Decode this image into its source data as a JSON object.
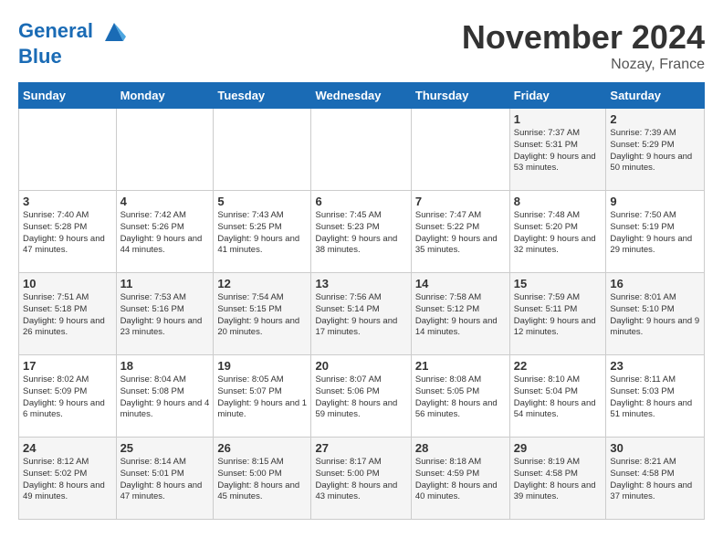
{
  "header": {
    "logo_line1": "General",
    "logo_line2": "Blue",
    "month": "November 2024",
    "location": "Nozay, France"
  },
  "weekdays": [
    "Sunday",
    "Monday",
    "Tuesday",
    "Wednesday",
    "Thursday",
    "Friday",
    "Saturday"
  ],
  "weeks": [
    [
      {
        "day": "",
        "info": ""
      },
      {
        "day": "",
        "info": ""
      },
      {
        "day": "",
        "info": ""
      },
      {
        "day": "",
        "info": ""
      },
      {
        "day": "",
        "info": ""
      },
      {
        "day": "1",
        "info": "Sunrise: 7:37 AM\nSunset: 5:31 PM\nDaylight: 9 hours\nand 53 minutes."
      },
      {
        "day": "2",
        "info": "Sunrise: 7:39 AM\nSunset: 5:29 PM\nDaylight: 9 hours\nand 50 minutes."
      }
    ],
    [
      {
        "day": "3",
        "info": "Sunrise: 7:40 AM\nSunset: 5:28 PM\nDaylight: 9 hours\nand 47 minutes."
      },
      {
        "day": "4",
        "info": "Sunrise: 7:42 AM\nSunset: 5:26 PM\nDaylight: 9 hours\nand 44 minutes."
      },
      {
        "day": "5",
        "info": "Sunrise: 7:43 AM\nSunset: 5:25 PM\nDaylight: 9 hours\nand 41 minutes."
      },
      {
        "day": "6",
        "info": "Sunrise: 7:45 AM\nSunset: 5:23 PM\nDaylight: 9 hours\nand 38 minutes."
      },
      {
        "day": "7",
        "info": "Sunrise: 7:47 AM\nSunset: 5:22 PM\nDaylight: 9 hours\nand 35 minutes."
      },
      {
        "day": "8",
        "info": "Sunrise: 7:48 AM\nSunset: 5:20 PM\nDaylight: 9 hours\nand 32 minutes."
      },
      {
        "day": "9",
        "info": "Sunrise: 7:50 AM\nSunset: 5:19 PM\nDaylight: 9 hours\nand 29 minutes."
      }
    ],
    [
      {
        "day": "10",
        "info": "Sunrise: 7:51 AM\nSunset: 5:18 PM\nDaylight: 9 hours\nand 26 minutes."
      },
      {
        "day": "11",
        "info": "Sunrise: 7:53 AM\nSunset: 5:16 PM\nDaylight: 9 hours\nand 23 minutes."
      },
      {
        "day": "12",
        "info": "Sunrise: 7:54 AM\nSunset: 5:15 PM\nDaylight: 9 hours\nand 20 minutes."
      },
      {
        "day": "13",
        "info": "Sunrise: 7:56 AM\nSunset: 5:14 PM\nDaylight: 9 hours\nand 17 minutes."
      },
      {
        "day": "14",
        "info": "Sunrise: 7:58 AM\nSunset: 5:12 PM\nDaylight: 9 hours\nand 14 minutes."
      },
      {
        "day": "15",
        "info": "Sunrise: 7:59 AM\nSunset: 5:11 PM\nDaylight: 9 hours\nand 12 minutes."
      },
      {
        "day": "16",
        "info": "Sunrise: 8:01 AM\nSunset: 5:10 PM\nDaylight: 9 hours\nand 9 minutes."
      }
    ],
    [
      {
        "day": "17",
        "info": "Sunrise: 8:02 AM\nSunset: 5:09 PM\nDaylight: 9 hours\nand 6 minutes."
      },
      {
        "day": "18",
        "info": "Sunrise: 8:04 AM\nSunset: 5:08 PM\nDaylight: 9 hours\nand 4 minutes."
      },
      {
        "day": "19",
        "info": "Sunrise: 8:05 AM\nSunset: 5:07 PM\nDaylight: 9 hours\nand 1 minute."
      },
      {
        "day": "20",
        "info": "Sunrise: 8:07 AM\nSunset: 5:06 PM\nDaylight: 8 hours\nand 59 minutes."
      },
      {
        "day": "21",
        "info": "Sunrise: 8:08 AM\nSunset: 5:05 PM\nDaylight: 8 hours\nand 56 minutes."
      },
      {
        "day": "22",
        "info": "Sunrise: 8:10 AM\nSunset: 5:04 PM\nDaylight: 8 hours\nand 54 minutes."
      },
      {
        "day": "23",
        "info": "Sunrise: 8:11 AM\nSunset: 5:03 PM\nDaylight: 8 hours\nand 51 minutes."
      }
    ],
    [
      {
        "day": "24",
        "info": "Sunrise: 8:12 AM\nSunset: 5:02 PM\nDaylight: 8 hours\nand 49 minutes."
      },
      {
        "day": "25",
        "info": "Sunrise: 8:14 AM\nSunset: 5:01 PM\nDaylight: 8 hours\nand 47 minutes."
      },
      {
        "day": "26",
        "info": "Sunrise: 8:15 AM\nSunset: 5:00 PM\nDaylight: 8 hours\nand 45 minutes."
      },
      {
        "day": "27",
        "info": "Sunrise: 8:17 AM\nSunset: 5:00 PM\nDaylight: 8 hours\nand 43 minutes."
      },
      {
        "day": "28",
        "info": "Sunrise: 8:18 AM\nSunset: 4:59 PM\nDaylight: 8 hours\nand 40 minutes."
      },
      {
        "day": "29",
        "info": "Sunrise: 8:19 AM\nSunset: 4:58 PM\nDaylight: 8 hours\nand 39 minutes."
      },
      {
        "day": "30",
        "info": "Sunrise: 8:21 AM\nSunset: 4:58 PM\nDaylight: 8 hours\nand 37 minutes."
      }
    ]
  ]
}
